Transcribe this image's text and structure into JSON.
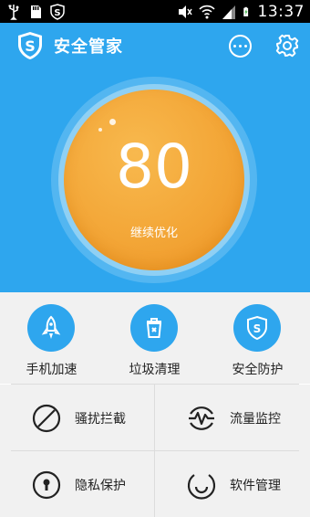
{
  "status_bar": {
    "time": "13:37"
  },
  "app": {
    "title": "安全管家"
  },
  "score": {
    "value": "80",
    "label": "继续优化"
  },
  "features": [
    {
      "label": "手机加速",
      "icon": "rocket-icon"
    },
    {
      "label": "垃圾清理",
      "icon": "trash-can-icon"
    },
    {
      "label": "安全防护",
      "icon": "shield-icon"
    }
  ],
  "grid": [
    {
      "label": "骚扰拦截",
      "icon": "block-icon"
    },
    {
      "label": "流量监控",
      "icon": "traffic-icon"
    },
    {
      "label": "隐私保护",
      "icon": "lock-icon"
    },
    {
      "label": "软件管理",
      "icon": "apps-icon"
    }
  ],
  "colors": {
    "accent": "#2ea6ee",
    "score": "#f3a637",
    "panel": "#f1f1f1"
  }
}
